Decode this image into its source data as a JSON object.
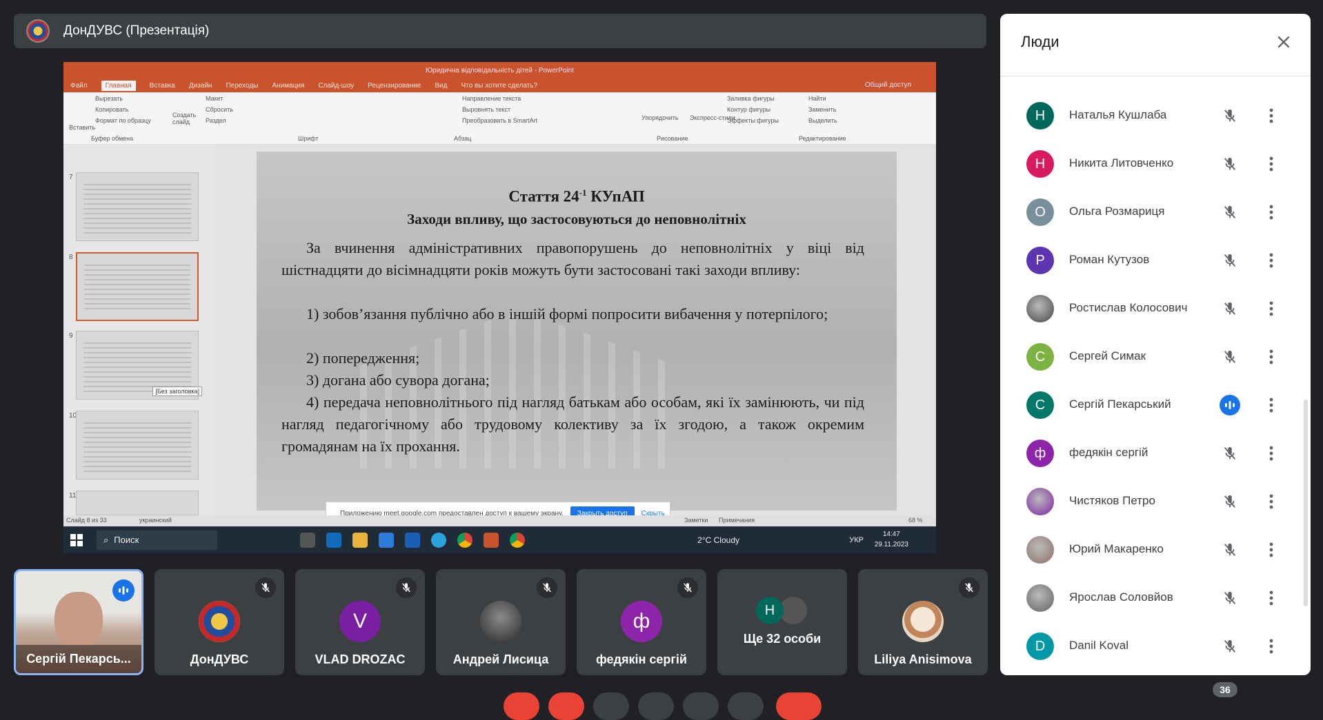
{
  "presentation": {
    "title": "ДонДУВС (Презентація)"
  },
  "ppt": {
    "window_title": "Юридична відповідальність дітей - PowerPoint",
    "tabs": [
      "Файл",
      "Главная",
      "Вставка",
      "Дизайн",
      "Переходы",
      "Анимация",
      "Слайд-шоу",
      "Рецензирование",
      "Вид",
      "Что вы хотите сделать?"
    ],
    "active_tab": "Главная",
    "share_label": "Общий доступ",
    "ribbon": {
      "paste": "Вставить",
      "cut": "Вырезать",
      "copy": "Копировать",
      "format_painter": "Формат по образцу",
      "clipboard_group": "Буфер обмена",
      "create_slide": "Создать слайд",
      "layout": "Макет",
      "reset": "Сбросить",
      "section": "Раздел",
      "font_group": "Шрифт",
      "paragraph_group": "Абзац",
      "direction": "Направление текста",
      "align_text": "Выровнять текст",
      "smartart": "Преобразовать в SmartArt",
      "arrange": "Упорядочить",
      "express_styles": "Экспресс-стили",
      "drawing_group": "Рисование",
      "fill": "Заливка фигуры",
      "outline": "Контур фигуры",
      "effects": "Эффекты фигуры",
      "find": "Найти",
      "replace": "Заменить",
      "select": "Выделить",
      "editing_group": "Редактирование"
    },
    "thumbnail_numbers": [
      "7",
      "8",
      "9",
      "10",
      "11"
    ],
    "thumbnail_tooltip": "[Без заголовка]",
    "slide": {
      "title1": "Стаття 24",
      "title1_sup": "-1",
      "title1_suffix": " КУпАП",
      "title2": "Заходи впливу, що застосовуються до неповнолітніх",
      "p1": "За вчинення адміністративних правопорушень до неповнолітніх у віці від шістнадцяти до вісімнадцяти років можуть бути застосовані такі заходи впливу:",
      "p2": "1) зобов’язання публічно або в іншій формі попросити вибачення у потерпілого;",
      "p3": "2) попередження;",
      "p4": "3) догана або сувора догана;",
      "p5": "4) передача неповнолітнього під нагляд батькам або особам, які їх замінюють, чи під нагляд педагогічному або трудовому колективу за їх згодою, а також окремим громадянам на їх прохання."
    },
    "share_notice": {
      "text": "Приложению meet.google.com предоставлен доступ к вашему экрану.",
      "stop": "Закрыть доступ",
      "hide": "Скрыть"
    },
    "statusbar": {
      "slide_info": "Слайд 8 из 33",
      "language": "украинский",
      "notes": "Заметки",
      "comments": "Примечания",
      "zoom": "68 %"
    }
  },
  "taskbar": {
    "search": "Поиск",
    "weather": "2°C Cloudy",
    "lang": "УКР",
    "time": "14:47",
    "date": "29.11.2023"
  },
  "tiles": [
    {
      "name": "Сергій Пекарсь...",
      "type": "video",
      "speaking": true
    },
    {
      "name": "ДонДУВС",
      "type": "logo",
      "muted": true
    },
    {
      "name": "VLAD DROZAC",
      "initial": "V",
      "color": "#7b1fa2",
      "muted": true
    },
    {
      "name": "Андрей Лисица",
      "type": "photo",
      "muted": true
    },
    {
      "name": "федякін сергій",
      "initial": "ф",
      "color": "#8e24aa",
      "muted": true
    },
    {
      "name": "Ще 32 особи",
      "type": "more",
      "initial": "Н",
      "color": "#00695c"
    },
    {
      "name": "Liliya Anisimova",
      "type": "photo2",
      "muted": true
    }
  ],
  "people": {
    "title": "Люди",
    "list": [
      {
        "name": "Наталья Кушлаба",
        "initial": "Н",
        "color": "#00695c",
        "muted": true
      },
      {
        "name": "Никита Литовченко",
        "initial": "Н",
        "color": "#d81b60",
        "muted": true
      },
      {
        "name": "Ольга Розмариця",
        "initial": "О",
        "color": "#78909c",
        "muted": true
      },
      {
        "name": "Роман Кутузов",
        "initial": "Р",
        "color": "#5e35b1",
        "muted": true
      },
      {
        "name": "Ростислав Колосович",
        "initial": "",
        "color": "#444444",
        "muted": true,
        "photo": true
      },
      {
        "name": "Сергей Симак",
        "initial": "С",
        "color": "#7cb342",
        "muted": true
      },
      {
        "name": "Сергій Пекарський",
        "initial": "С",
        "color": "#00796b",
        "muted": false
      },
      {
        "name": "федякін сергій",
        "initial": "ф",
        "color": "#8e24aa",
        "muted": true
      },
      {
        "name": "Чистяков Петро",
        "initial": "",
        "color": "#7b1fa2",
        "muted": true,
        "photo": true
      },
      {
        "name": "Юрий Макаренко",
        "initial": "",
        "color": "#8d6e63",
        "muted": true,
        "photo": true
      },
      {
        "name": "Ярослав Соловйов",
        "initial": "",
        "color": "#616161",
        "muted": true,
        "photo": true
      },
      {
        "name": "Danil Koval",
        "initial": "D",
        "color": "#0097a7",
        "muted": true
      }
    ]
  },
  "participant_count": "36",
  "colors": {
    "background": "#202124",
    "accent": "#1a73e8",
    "ppt_orange": "#c8532d"
  }
}
